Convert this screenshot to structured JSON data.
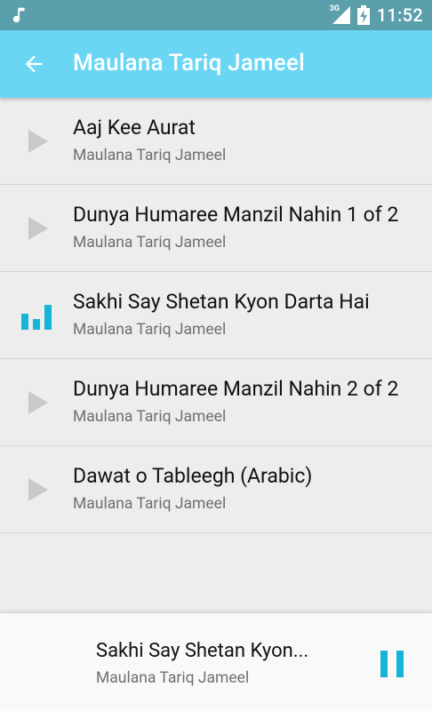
{
  "status_bar": {
    "network": "3G",
    "time": "11:52"
  },
  "app_bar": {
    "title": "Maulana Tariq Jameel"
  },
  "tracks": [
    {
      "title": "Aaj Kee Aurat",
      "artist": "Maulana Tariq Jameel",
      "icon": "play-icon"
    },
    {
      "title": "Dunya Humaree Manzil Nahin 1 of 2",
      "artist": "Maulana Tariq Jameel",
      "icon": "play-icon"
    },
    {
      "title": "Sakhi Say Shetan Kyon Darta Hai",
      "artist": "Maulana Tariq Jameel",
      "icon": "equalizer-icon"
    },
    {
      "title": "Dunya Humaree Manzil Nahin 2 of 2",
      "artist": "Maulana Tariq Jameel",
      "icon": "play-icon"
    },
    {
      "title": "Dawat o Tableegh (Arabic)",
      "artist": "Maulana Tariq Jameel",
      "icon": "play-icon"
    }
  ],
  "now_playing": {
    "title": "Sakhi Say Shetan Kyon...",
    "artist": "Maulana Tariq Jameel",
    "control": "pause-icon"
  },
  "colors": {
    "status_bar": "#5b9faa",
    "app_bar": "#6ad6f4",
    "accent": "#15b3d6",
    "play_icon": "#c9c9c9",
    "background": "#ededed"
  }
}
